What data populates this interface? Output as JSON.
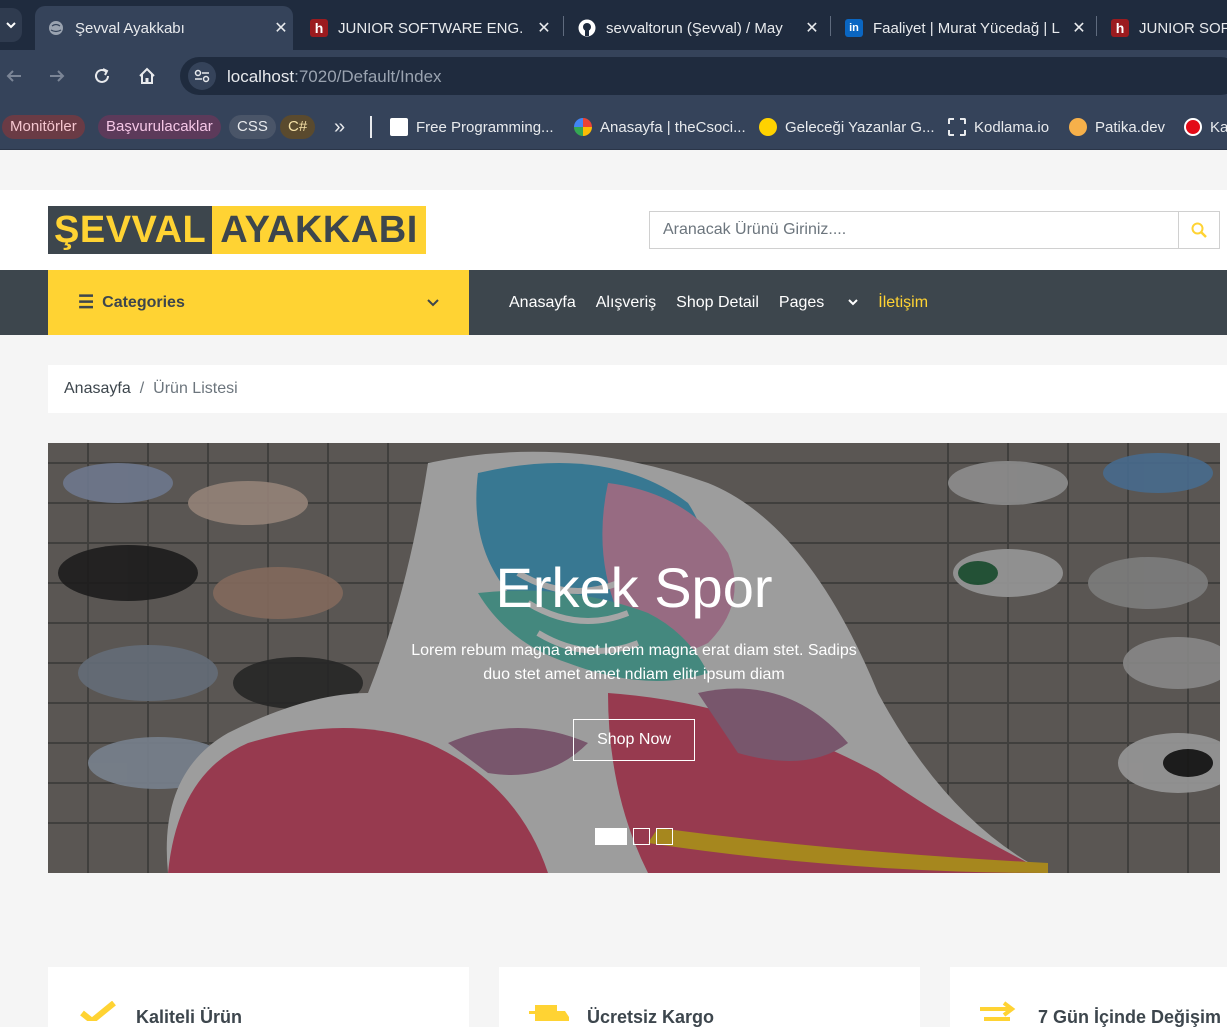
{
  "browser": {
    "tabs": [
      {
        "title": "Şevval Ayakkabı",
        "active": true
      },
      {
        "title": "JUNIOR SOFTWARE ENG.",
        "active": false
      },
      {
        "title": "sevvaltorun (Şevval) / May",
        "active": false
      },
      {
        "title": "Faaliyet | Murat Yücedağ | L",
        "active": false
      },
      {
        "title": "JUNIOR SOFT",
        "active": false
      }
    ],
    "url_host": "localhost",
    "url_path": ":7020/Default/Index",
    "bookmarks": {
      "chips": [
        "Monitörler",
        "Başvurulacaklar",
        "CSS",
        "C#"
      ],
      "overflow": "»",
      "items": [
        "Free Programming...",
        "Anasayfa | theCsoci...",
        "Geleceği Yazanlar G...",
        "Kodlama.io",
        "Patika.dev",
        "Ka"
      ]
    }
  },
  "site": {
    "logo_part1": "ŞEVVAL",
    "logo_part2": "AYAKKABI",
    "search_placeholder": "Aranacak Ürünü Giriniz....",
    "categories_label": "Categories",
    "menu": [
      "Anasayfa",
      "Alışveriş",
      "Shop Detail",
      "Pages",
      "İletişim"
    ],
    "breadcrumb": {
      "home": "Anasayfa",
      "separator": "/",
      "current": "Ürün Listesi"
    },
    "hero": {
      "title": "Erkek Spor",
      "text": "Lorem rebum magna amet lorem magna erat diam stet. Sadips duo stet amet amet ndiam elitr ipsum diam",
      "button": "Shop Now",
      "slides": 3,
      "active_slide": 1
    },
    "features": [
      "Kaliteli Ürün",
      "Ücretsiz Kargo",
      "7 Gün İçinde Değişim"
    ],
    "colors": {
      "primary": "#ffd333",
      "dark": "#3d464d",
      "chrome_dark": "#1f2b3e",
      "chrome_mid": "#35435a"
    }
  }
}
